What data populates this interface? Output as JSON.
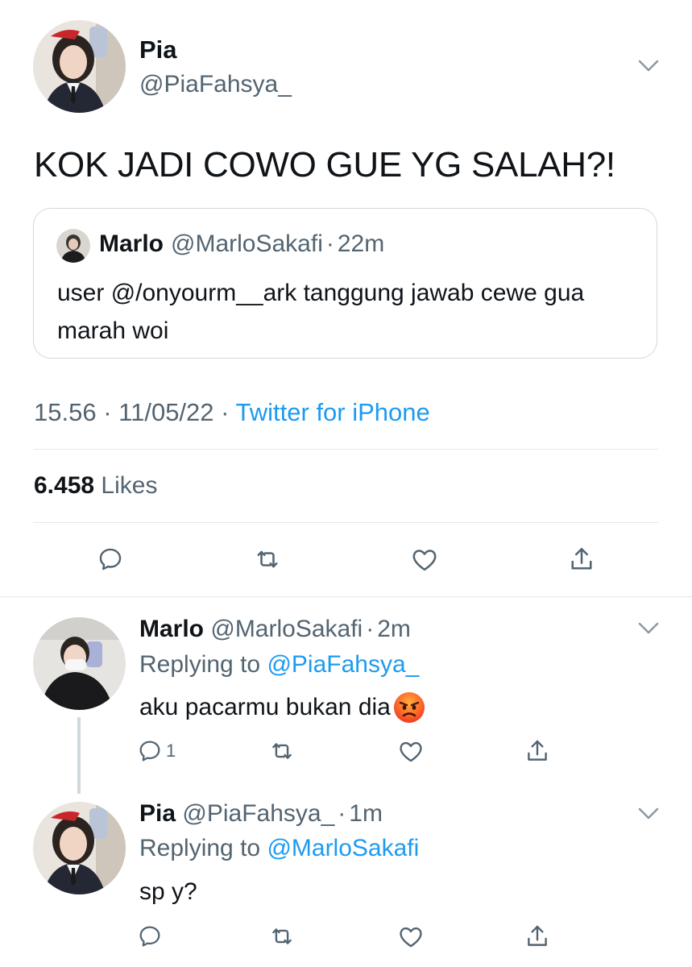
{
  "colors": {
    "text": "#0f1419",
    "secondary": "#536471",
    "link": "#1d9bf0",
    "border": "#cfd9de",
    "divider": "#e1e8ed"
  },
  "main_tweet": {
    "author_name": "Pia",
    "author_handle": "@PiaFahsya_",
    "menu_icon": "chevron-down-icon",
    "text": "KOK JADI COWO GUE YG SALAH?!",
    "quote": {
      "author_name": "Marlo",
      "author_handle": "@MarloSakafi",
      "separator": "·",
      "time": "22m",
      "text": "user @/onyourm__ark tanggung jawab cewe gua marah woi"
    },
    "time": "15.56",
    "date": "11/05/22",
    "meta_separator": "·",
    "source": "Twitter for iPhone",
    "likes_count": "6.458",
    "likes_label": "Likes",
    "actions": [
      "reply-icon",
      "retweet-icon",
      "like-icon",
      "share-icon"
    ]
  },
  "replies": [
    {
      "author_name": "Marlo",
      "author_handle": "@MarloSakafi",
      "separator": "·",
      "time": "2m",
      "replying_label": "Replying to",
      "replying_handle": "@PiaFahsya_",
      "text": "aku pacarmu bukan dia",
      "emoji": "angry-face-emoji",
      "reply_count": "1"
    },
    {
      "author_name": "Pia",
      "author_handle": "@PiaFahsya_",
      "separator": "·",
      "time": "1m",
      "replying_label": "Replying to",
      "replying_handle": "@MarloSakafi",
      "text": "sp y?",
      "reply_count": ""
    }
  ]
}
